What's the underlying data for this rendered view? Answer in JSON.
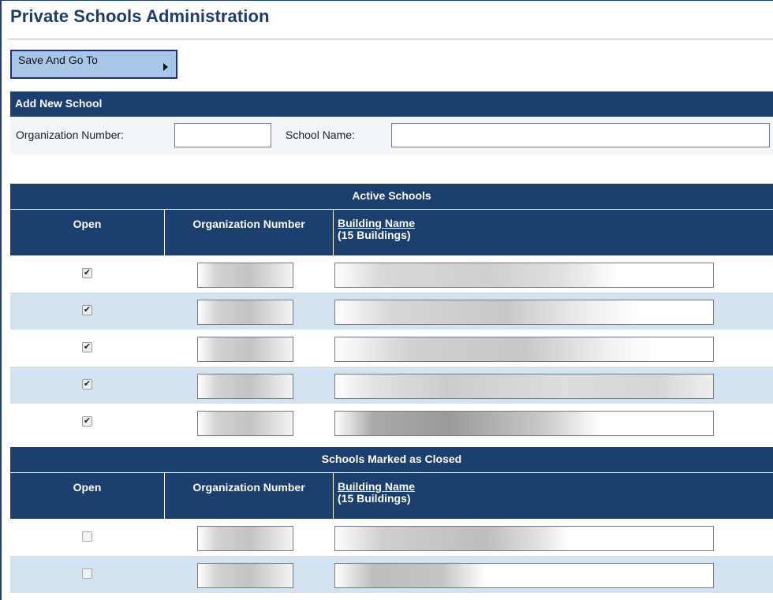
{
  "page": {
    "title": "Private Schools Administration"
  },
  "toolbar": {
    "save_go_label": "Save And Go To"
  },
  "add_new": {
    "header": "Add New School",
    "org_label": "Organization Number:",
    "org_value": "",
    "school_label": "School Name:",
    "school_value": ""
  },
  "active": {
    "caption": "Active Schools",
    "col_open": "Open",
    "col_org": "Organization Number",
    "col_building": "Building Name",
    "col_building_count": "(15 Buildings)",
    "rows": [
      {
        "open": true
      },
      {
        "open": true
      },
      {
        "open": true
      },
      {
        "open": true
      },
      {
        "open": true
      }
    ]
  },
  "closed": {
    "caption": "Schools Marked as Closed",
    "col_open": "Open",
    "col_org": "Organization Number",
    "col_building": "Building Name",
    "col_building_count": "(15 Buildings)",
    "rows": [
      {
        "open": false
      },
      {
        "open": false
      }
    ]
  },
  "icons": {
    "save_go": "caret-right-icon",
    "checkbox_checked": "checkmark-icon"
  },
  "colors": {
    "header_bg": "#1b3f6e",
    "row_alt": "#d3e2f0",
    "button_bg": "#a6c7e7",
    "title": "#1c3d6b"
  }
}
